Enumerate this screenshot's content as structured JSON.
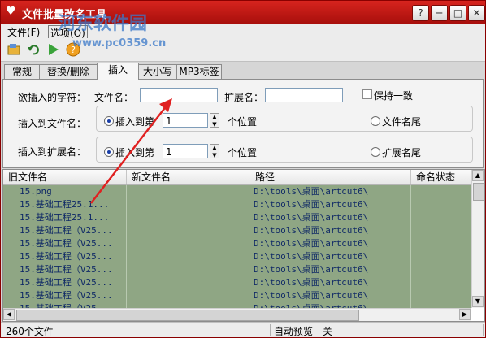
{
  "window": {
    "title": "文件批量改名工具",
    "controls": [
      "?",
      "─",
      "□",
      "✕"
    ]
  },
  "watermark": {
    "line1": "河东软件园",
    "line2": "www.pc0359.cn"
  },
  "menu": {
    "items": [
      "文件(F)",
      "选项(O)"
    ]
  },
  "tabs": [
    "常规",
    "替换/删除",
    "插入",
    "大小写",
    "MP3标签"
  ],
  "active_tab": "插入",
  "insert_panel": {
    "chars_label": "欲插入的字符：",
    "filename_label": "文件名：",
    "filename_value": "",
    "ext_label": "扩展名：",
    "ext_value": "",
    "keep_same_label": "保持一致",
    "keep_same_checked": false,
    "to_filename_label": "插入到文件名：",
    "to_filename_pos_label": "插入到第",
    "to_filename_value": "1",
    "to_filename_unit": "个位置",
    "to_filename_end_label": "文件名尾",
    "to_ext_label": "插入到扩展名：",
    "to_ext_pos_label": "插入到第",
    "to_ext_value": "1",
    "to_ext_unit": "个位置",
    "to_ext_end_label": "扩展名尾"
  },
  "list": {
    "columns": [
      "旧文件名",
      "新文件名",
      "路径",
      "命名状态"
    ],
    "rows": [
      [
        "15.png",
        "",
        "D:\\tools\\桌面\\artcut6\\",
        ""
      ],
      [
        "15.基础工程25.1...",
        "",
        "D:\\tools\\桌面\\artcut6\\",
        ""
      ],
      [
        "15.基础工程25.1...",
        "",
        "D:\\tools\\桌面\\artcut6\\",
        ""
      ],
      [
        "15.基础工程（V25...",
        "",
        "D:\\tools\\桌面\\artcut6\\",
        ""
      ],
      [
        "15.基础工程（V25...",
        "",
        "D:\\tools\\桌面\\artcut6\\",
        ""
      ],
      [
        "15.基础工程（V25...",
        "",
        "D:\\tools\\桌面\\artcut6\\",
        ""
      ],
      [
        "15.基础工程（V25...",
        "",
        "D:\\tools\\桌面\\artcut6\\",
        ""
      ],
      [
        "15.基础工程（V25...",
        "",
        "D:\\tools\\桌面\\artcut6\\",
        ""
      ],
      [
        "15.基础工程（V25...",
        "",
        "D:\\tools\\桌面\\artcut6\\",
        ""
      ],
      [
        "15.基础工程（V25...",
        "",
        "D:\\tools\\桌面\\artcut6\\",
        ""
      ]
    ]
  },
  "status": {
    "count": "260个文件",
    "preview": "自动预览 - 关"
  },
  "colors": {
    "titlebar": "#c11a16",
    "row_bg": "#8fa684",
    "row_text": "#102a66"
  },
  "icons": [
    "heart-icon",
    "open-icon",
    "undo-icon",
    "rename-icon",
    "help-icon"
  ]
}
